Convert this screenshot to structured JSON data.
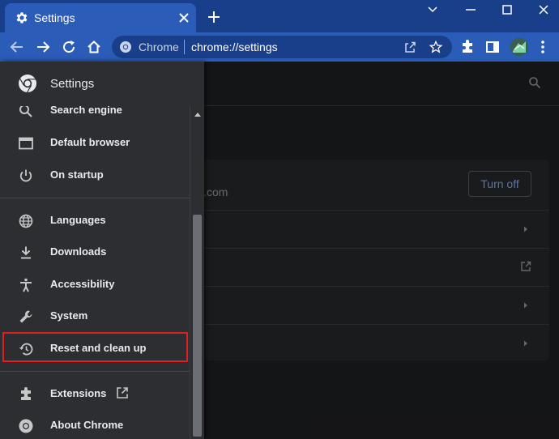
{
  "browser": {
    "tab_title": "Settings",
    "omnibox_site": "Chrome",
    "omnibox_url": "chrome://settings"
  },
  "settings": {
    "drawer_title": "Settings",
    "nav_items": [
      {
        "label": "Search engine",
        "icon": "search-icon"
      },
      {
        "label": "Default browser",
        "icon": "browser-icon"
      },
      {
        "label": "On startup",
        "icon": "power-icon"
      },
      {
        "label": "Languages",
        "icon": "globe-icon"
      },
      {
        "label": "Downloads",
        "icon": "download-icon"
      },
      {
        "label": "Accessibility",
        "icon": "accessibility-icon"
      },
      {
        "label": "System",
        "icon": "wrench-icon"
      },
      {
        "label": "Reset and clean up",
        "icon": "restore-icon",
        "highlighted": true
      },
      {
        "label": "Extensions",
        "icon": "puzzle-icon",
        "external": true
      },
      {
        "label": "About Chrome",
        "icon": "chrome-logo-icon"
      }
    ]
  },
  "main": {
    "sync_email_fragment": "l.com",
    "turn_off_label": "Turn off"
  },
  "colors": {
    "titlebar": "#1a3f8a",
    "toolbar": "#2b5cb8",
    "drawer_bg": "#2d2e31",
    "highlight_border": "#e02020",
    "link_blue": "#8ab4f8"
  }
}
